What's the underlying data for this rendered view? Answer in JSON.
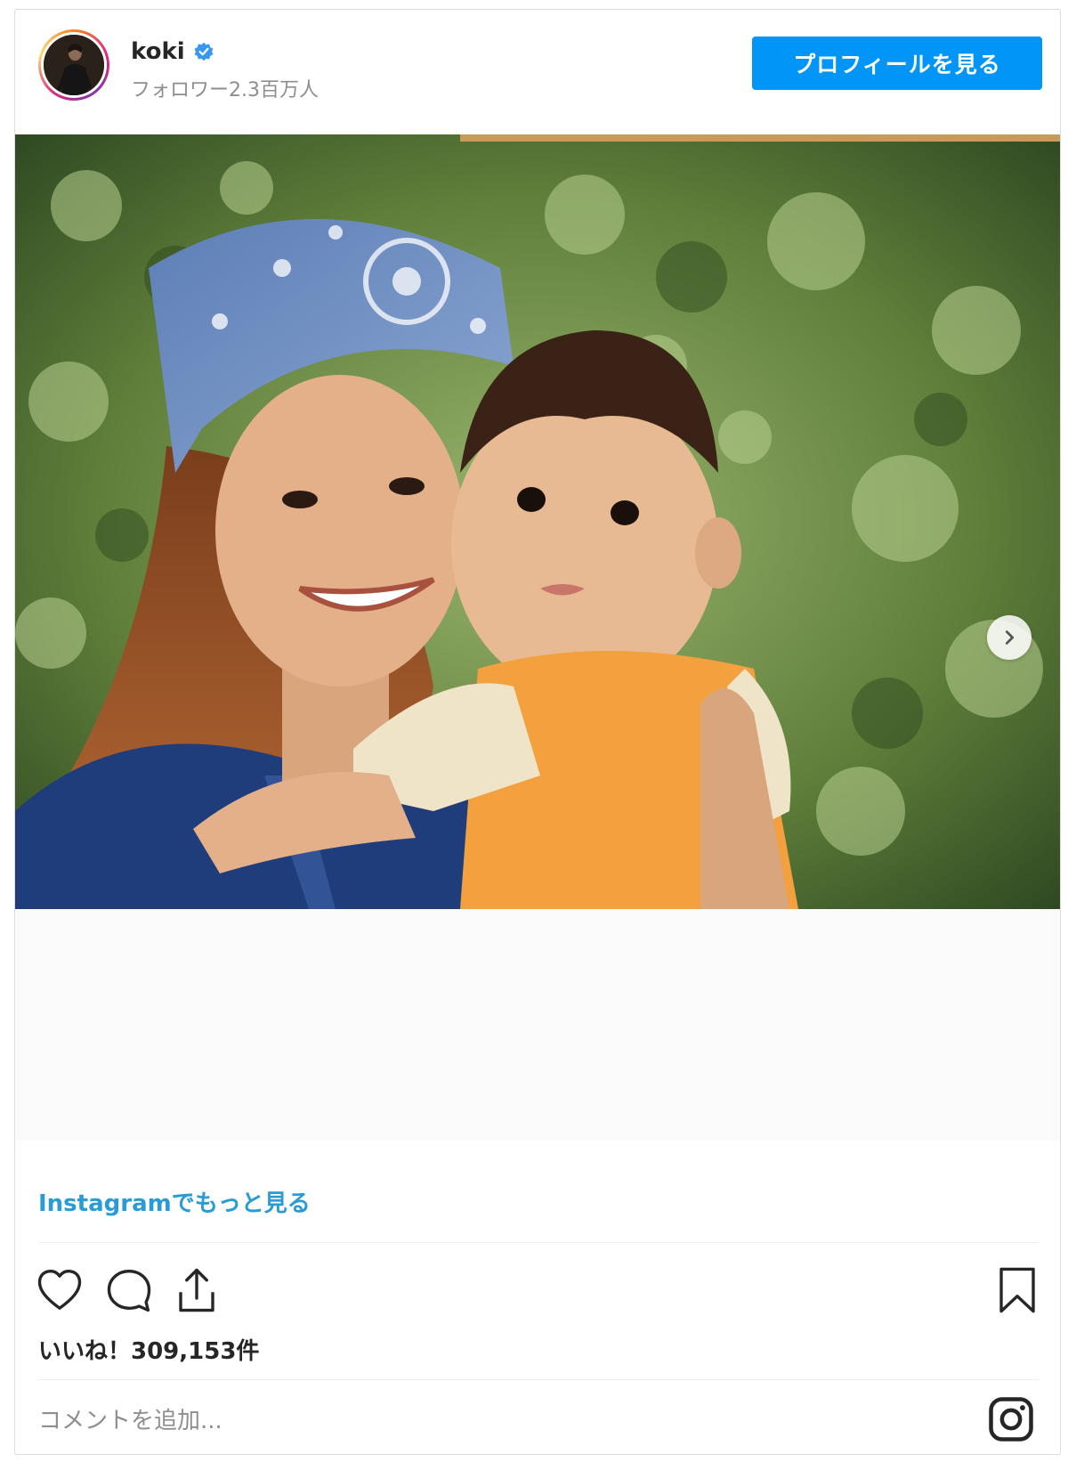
{
  "header": {
    "username": "koki",
    "followers": "フォロワー2.3百万人",
    "profile_button": "プロフィールを見る",
    "verified_icon": "verified-badge-icon"
  },
  "post": {
    "image_alt": "",
    "next_icon": "chevron-right-icon",
    "view_more": "Instagramでもっと見る",
    "likes": "いいね！309,153件",
    "comment_placeholder": "コメントを追加...",
    "icons": [
      "heart-icon",
      "comment-icon",
      "share-icon",
      "bookmark-icon",
      "instagram-logo-icon"
    ]
  },
  "colors": {
    "accent": "#0095f6",
    "link": "#2b9bd6",
    "text": "#262626",
    "muted": "#8e8e8e",
    "border": "#dbdbdb"
  }
}
